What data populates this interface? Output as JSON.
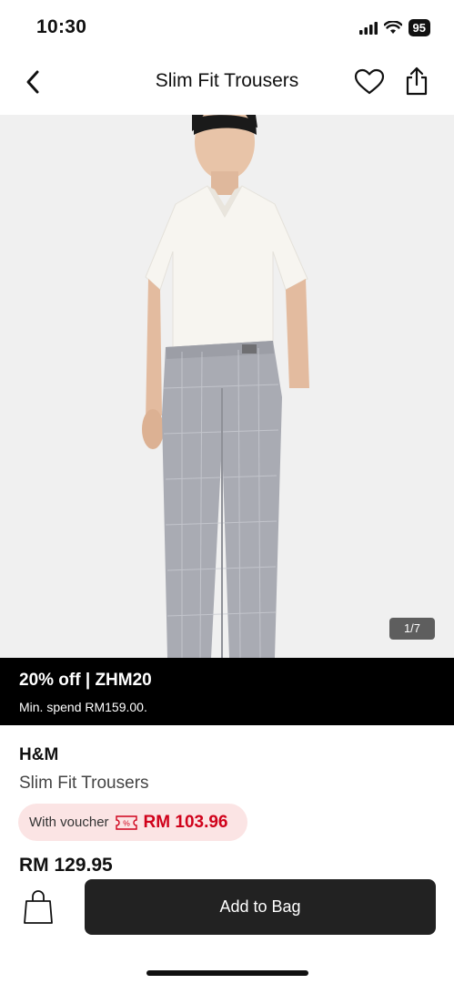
{
  "status_bar": {
    "time": "10:30",
    "battery": "95",
    "icons": [
      "signal-icon",
      "wifi-icon",
      "battery-icon"
    ]
  },
  "header": {
    "title": "Slim Fit Trousers",
    "icons": [
      "back-arrow-icon",
      "heart-icon",
      "share-icon"
    ]
  },
  "gallery": {
    "counter": "1/7"
  },
  "promo": {
    "title": "20% off | ZHM20",
    "subtitle": "Min. spend RM159.00."
  },
  "product": {
    "brand": "H&M",
    "name": "Slim Fit Trousers",
    "voucher_label": "With voucher",
    "voucher_icon": "voucher-ticket-icon",
    "voucher_price": "RM 103.96",
    "price": "RM 129.95"
  },
  "bottom_bar": {
    "bag_icon": "shopping-bag-icon",
    "add_to_bag_label": "Add to Bag"
  },
  "colors": {
    "promo_bg": "#000000",
    "voucher_bg": "#fbe4e4",
    "voucher_price": "#d0021b",
    "button_bg": "#222222",
    "image_bg": "#f0f0f0"
  }
}
